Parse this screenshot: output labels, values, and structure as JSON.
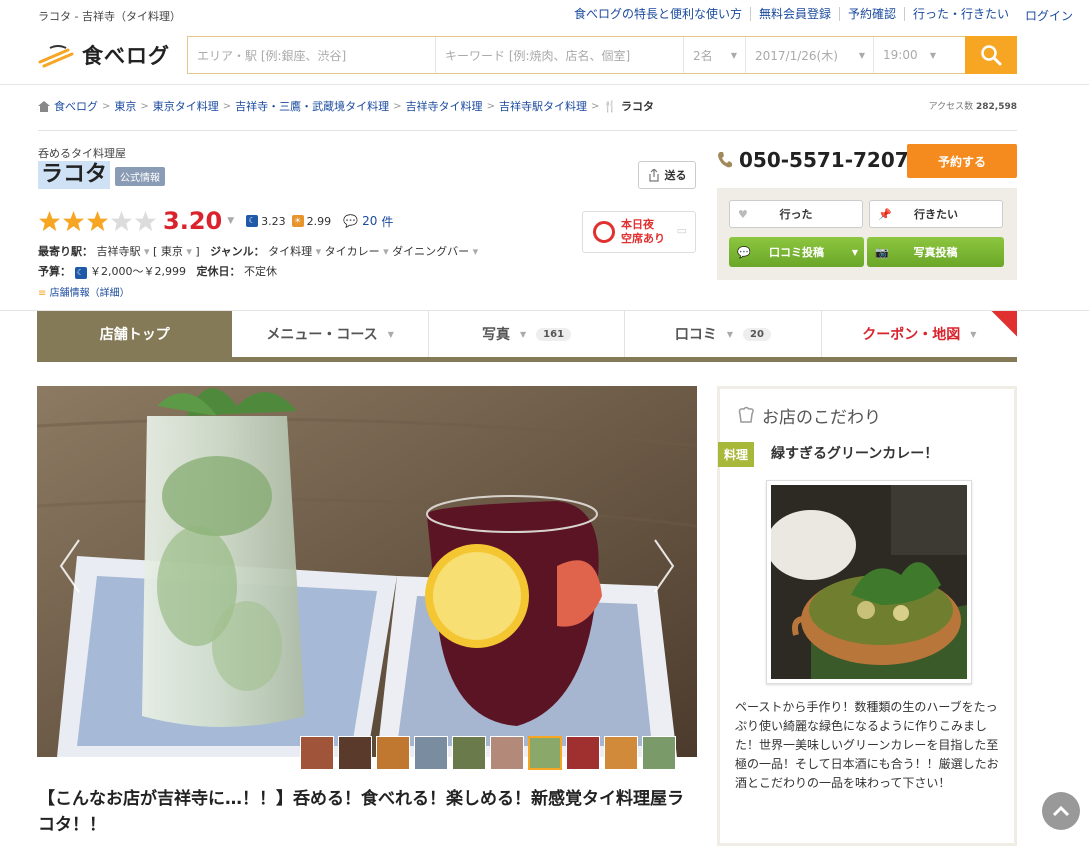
{
  "page_title": "ラコタ - 吉祥寺（タイ料理）",
  "top_links": [
    "食べログの特長と便利な使い方",
    "無料会員登録",
    "予約確認",
    "行った・行きたい"
  ],
  "login_label": "ログイン",
  "logo_text": "食べログ",
  "search": {
    "area_placeholder": "エリア・駅 [例:銀座、渋谷]",
    "keyword_placeholder": "キーワード [例:焼肉、店名、個室]",
    "people": "2名",
    "date": "2017/1/26(木)",
    "time": "19:00"
  },
  "breadcrumb": [
    "食べログ",
    "東京",
    "東京タイ料理",
    "吉祥寺・三鷹・武蔵境タイ料理",
    "吉祥寺タイ料理",
    "吉祥寺駅タイ料理"
  ],
  "breadcrumb_current": "ラコタ",
  "access_label": "アクセス数",
  "access_count": "282,598",
  "shop": {
    "subcategory": "呑めるタイ料理屋",
    "name": "ラコタ",
    "official": "公式情報",
    "send": "送る",
    "rating": "3.20",
    "stars": 3,
    "night_score": "3.23",
    "lunch_score": "2.99",
    "review_count": "20",
    "review_unit": "件",
    "station_label": "最寄り駅：",
    "station": "吉祥寺駅",
    "area": "東京",
    "genre_label": "ジャンル：",
    "genres": [
      "タイ料理",
      "タイカレー",
      "ダイニングバー"
    ],
    "budget_label": "予算：",
    "budget": "￥2,000～￥2,999",
    "holiday_label": "定休日：",
    "holiday": "不定休",
    "shop_info_link": "店舗情報（詳細）",
    "vacancy_line1": "本日夜",
    "vacancy_line2": "空席あり"
  },
  "phone": "050-5571-7207",
  "reserve_label": "予約する",
  "actions": {
    "went": "行った",
    "want": "行きたい",
    "review": "口コミ投稿",
    "photo": "写真投稿"
  },
  "tabs": [
    {
      "label": "店舗トップ",
      "count": ""
    },
    {
      "label": "メニュー・コース",
      "count": ""
    },
    {
      "label": "写真",
      "count": "161"
    },
    {
      "label": "口コミ",
      "count": "20"
    },
    {
      "label": "クーポン・地図",
      "count": ""
    }
  ],
  "headline": "【こんなお店が吉祥寺に…！！】呑める！食べれる！楽しめる！新感覚タイ料理屋ラコタ！！",
  "kodawari": {
    "title": "お店のこだわり",
    "tag": "料理",
    "item_title": "緑すぎるグリーンカレー！",
    "text": "ペーストから手作り！数種類の生のハーブをたっぷり使い綺麗な緑色になるように作りこみました！世界一美味しいグリーンカレーを目指した至極の一品！そして日本酒にも合う！！厳選したお酒とこだわりの一品を味わって下さい！"
  },
  "colors": {
    "accent": "#f6a623",
    "tab_active": "#857a57",
    "rating": "#d9232d",
    "link": "#1a4a9e",
    "green": "#8dc63f"
  }
}
